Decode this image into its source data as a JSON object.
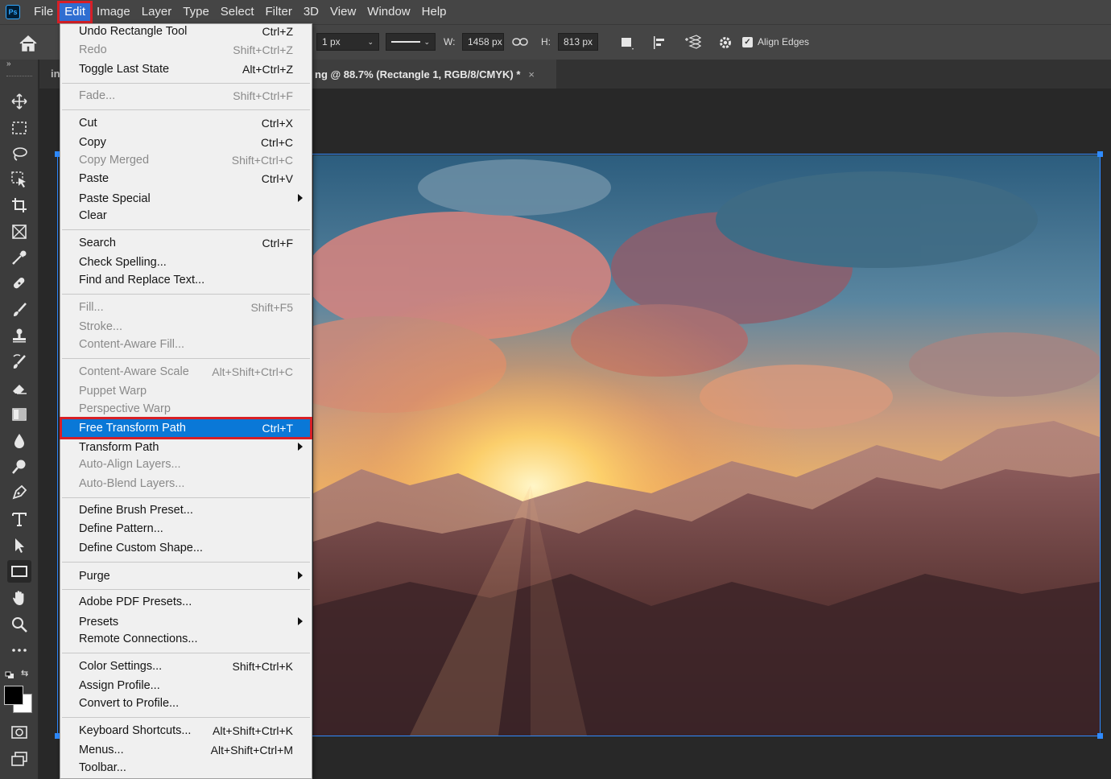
{
  "app": {
    "logo_text": "Ps"
  },
  "menubar": {
    "items": [
      "File",
      "Edit",
      "Image",
      "Layer",
      "Type",
      "Select",
      "Filter",
      "3D",
      "View",
      "Window",
      "Help"
    ],
    "active": "Edit"
  },
  "options": {
    "stroke_width": "1 px",
    "w_label": "W:",
    "w_value": "1458 px",
    "h_label": "H:",
    "h_value": "813 px",
    "align_edges_label": "Align Edges",
    "align_edges_checked": true
  },
  "document": {
    "tab_title": "ng @ 88.7% (Rectangle 1, RGB/8/CMYK) *",
    "tab_close": "×",
    "other_tab_fragment": "in"
  },
  "edit_menu": {
    "items": [
      {
        "label": "Undo Rectangle Tool",
        "shortcut": "Ctrl+Z",
        "enabled": true
      },
      {
        "label": "Redo",
        "shortcut": "Shift+Ctrl+Z",
        "enabled": false
      },
      {
        "label": "Toggle Last State",
        "shortcut": "Alt+Ctrl+Z",
        "enabled": true
      },
      {
        "label": "Fade...",
        "shortcut": "Shift+Ctrl+F",
        "enabled": false
      },
      {
        "label": "Cut",
        "shortcut": "Ctrl+X",
        "enabled": true
      },
      {
        "label": "Copy",
        "shortcut": "Ctrl+C",
        "enabled": true
      },
      {
        "label": "Copy Merged",
        "shortcut": "Shift+Ctrl+C",
        "enabled": false
      },
      {
        "label": "Paste",
        "shortcut": "Ctrl+V",
        "enabled": true
      },
      {
        "label": "Paste Special",
        "shortcut": "",
        "enabled": true,
        "submenu": true
      },
      {
        "label": "Clear",
        "shortcut": "",
        "enabled": true
      },
      {
        "label": "Search",
        "shortcut": "Ctrl+F",
        "enabled": true
      },
      {
        "label": "Check Spelling...",
        "shortcut": "",
        "enabled": true
      },
      {
        "label": "Find and Replace Text...",
        "shortcut": "",
        "enabled": true
      },
      {
        "label": "Fill...",
        "shortcut": "Shift+F5",
        "enabled": false
      },
      {
        "label": "Stroke...",
        "shortcut": "",
        "enabled": false
      },
      {
        "label": "Content-Aware Fill...",
        "shortcut": "",
        "enabled": false
      },
      {
        "label": "Content-Aware Scale",
        "shortcut": "Alt+Shift+Ctrl+C",
        "enabled": false
      },
      {
        "label": "Puppet Warp",
        "shortcut": "",
        "enabled": false
      },
      {
        "label": "Perspective Warp",
        "shortcut": "",
        "enabled": false
      },
      {
        "label": "Free Transform Path",
        "shortcut": "Ctrl+T",
        "enabled": true,
        "highlighted": true
      },
      {
        "label": "Transform Path",
        "shortcut": "",
        "enabled": true,
        "submenu": true
      },
      {
        "label": "Auto-Align Layers...",
        "shortcut": "",
        "enabled": false
      },
      {
        "label": "Auto-Blend Layers...",
        "shortcut": "",
        "enabled": false
      },
      {
        "label": "Define Brush Preset...",
        "shortcut": "",
        "enabled": true
      },
      {
        "label": "Define Pattern...",
        "shortcut": "",
        "enabled": true
      },
      {
        "label": "Define Custom Shape...",
        "shortcut": "",
        "enabled": true
      },
      {
        "label": "Purge",
        "shortcut": "",
        "enabled": true,
        "submenu": true
      },
      {
        "label": "Adobe PDF Presets...",
        "shortcut": "",
        "enabled": true
      },
      {
        "label": "Presets",
        "shortcut": "",
        "enabled": true,
        "submenu": true
      },
      {
        "label": "Remote Connections...",
        "shortcut": "",
        "enabled": true
      },
      {
        "label": "Color Settings...",
        "shortcut": "Shift+Ctrl+K",
        "enabled": true
      },
      {
        "label": "Assign Profile...",
        "shortcut": "",
        "enabled": true
      },
      {
        "label": "Convert to Profile...",
        "shortcut": "",
        "enabled": true
      },
      {
        "label": "Keyboard Shortcuts...",
        "shortcut": "Alt+Shift+Ctrl+K",
        "enabled": true
      },
      {
        "label": "Menus...",
        "shortcut": "Alt+Shift+Ctrl+M",
        "enabled": true
      },
      {
        "label": "Toolbar...",
        "shortcut": "",
        "enabled": true
      }
    ]
  },
  "tools": [
    "move-icon",
    "marquee-icon",
    "lasso-icon",
    "object-select-icon",
    "crop-icon",
    "frame-icon",
    "eyedropper-icon",
    "healing-icon",
    "brush-icon",
    "stamp-icon",
    "history-brush-icon",
    "eraser-icon",
    "gradient-icon",
    "blur-icon",
    "dodge-icon",
    "pen-icon",
    "type-icon",
    "path-select-icon",
    "rectangle-icon",
    "hand-icon",
    "zoom-icon",
    "more-icon"
  ],
  "colors": {
    "accent": "#0a78d7",
    "highlight_outline": "#d81f26",
    "selection": "#2f8bff"
  }
}
